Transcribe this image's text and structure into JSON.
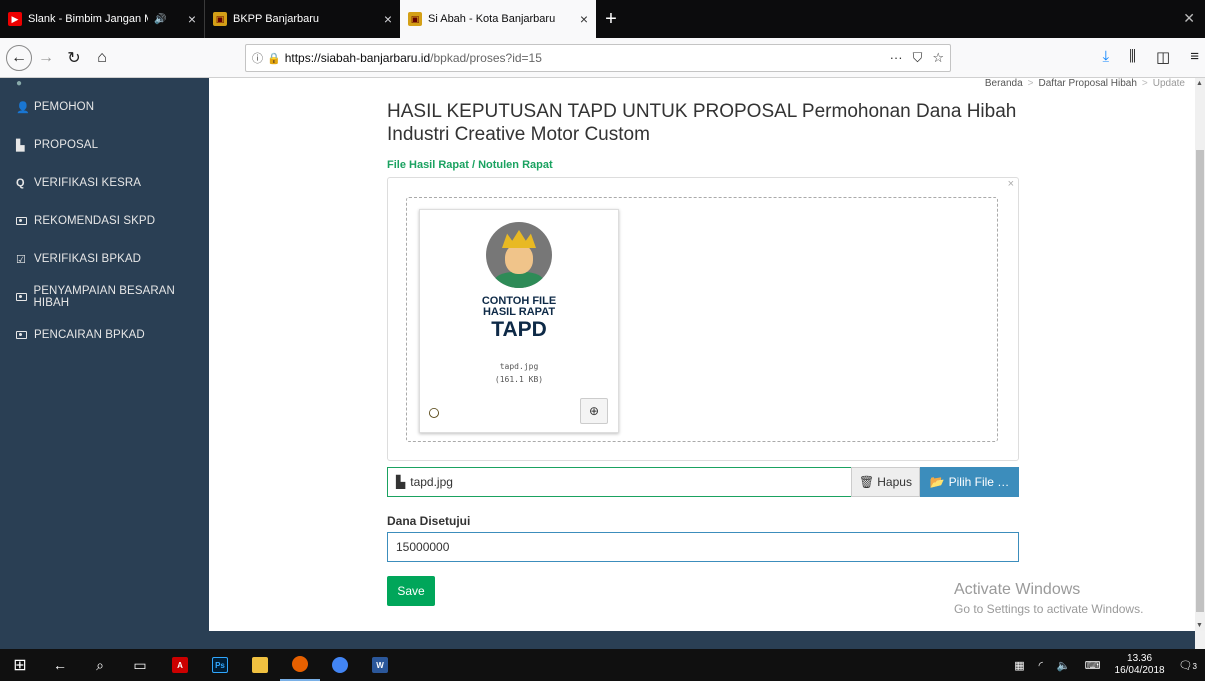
{
  "browser": {
    "tabs": [
      {
        "title": "Slank - Bimbim Jangan Me",
        "audio_icon": "speaker-icon"
      },
      {
        "title": "BKPP Banjarbaru"
      },
      {
        "title": "Si Abah - Kota Banjarbaru"
      }
    ],
    "url_host": "https://siabah-banjarbaru.id",
    "url_path": "/bpkad/proses?id=15"
  },
  "sidebar": {
    "items": [
      {
        "label": "PEMOHON",
        "icon": "user-icon"
      },
      {
        "label": "PROPOSAL",
        "icon": "file-icon"
      },
      {
        "label": "VERIFIKASI KESRA",
        "icon": "search-icon"
      },
      {
        "label": "REKOMENDASI SKPD",
        "icon": "money-icon"
      },
      {
        "label": "VERIFIKASI BPKAD",
        "icon": "check-square-icon"
      },
      {
        "label": "PENYAMPAIAN BESARAN HIBAH",
        "icon": "money-icon"
      },
      {
        "label": "PENCAIRAN BPKAD",
        "icon": "money-icon"
      }
    ]
  },
  "breadcrumb": {
    "home": "Beranda",
    "list": "Daftar Proposal Hibah",
    "current": "Update"
  },
  "page": {
    "title": "HASIL KEPUTUSAN TAPD UNTUK PROPOSAL Permohonan Dana Hibah Industri Creative Motor Custom",
    "file_label": "File Hasil Rapat / Notulen Rapat"
  },
  "preview": {
    "image_line1": "CONTOH FILE",
    "image_line2": "HASIL RAPAT",
    "image_line3": "TAPD",
    "file_name": "tapd.jpg",
    "file_size": "(161.1 KB)"
  },
  "file_input": {
    "caption": "tapd.jpg",
    "remove_label": "Hapus",
    "browse_label": "Pilih File …"
  },
  "form": {
    "dana_label": "Dana Disetujui",
    "dana_value": "15000000",
    "save_label": "Save"
  },
  "watermark": {
    "line1": "Activate Windows",
    "line2": "Go to Settings to activate Windows."
  },
  "taskbar": {
    "time": "13.36",
    "date": "16/04/2018",
    "notifications": "3"
  }
}
